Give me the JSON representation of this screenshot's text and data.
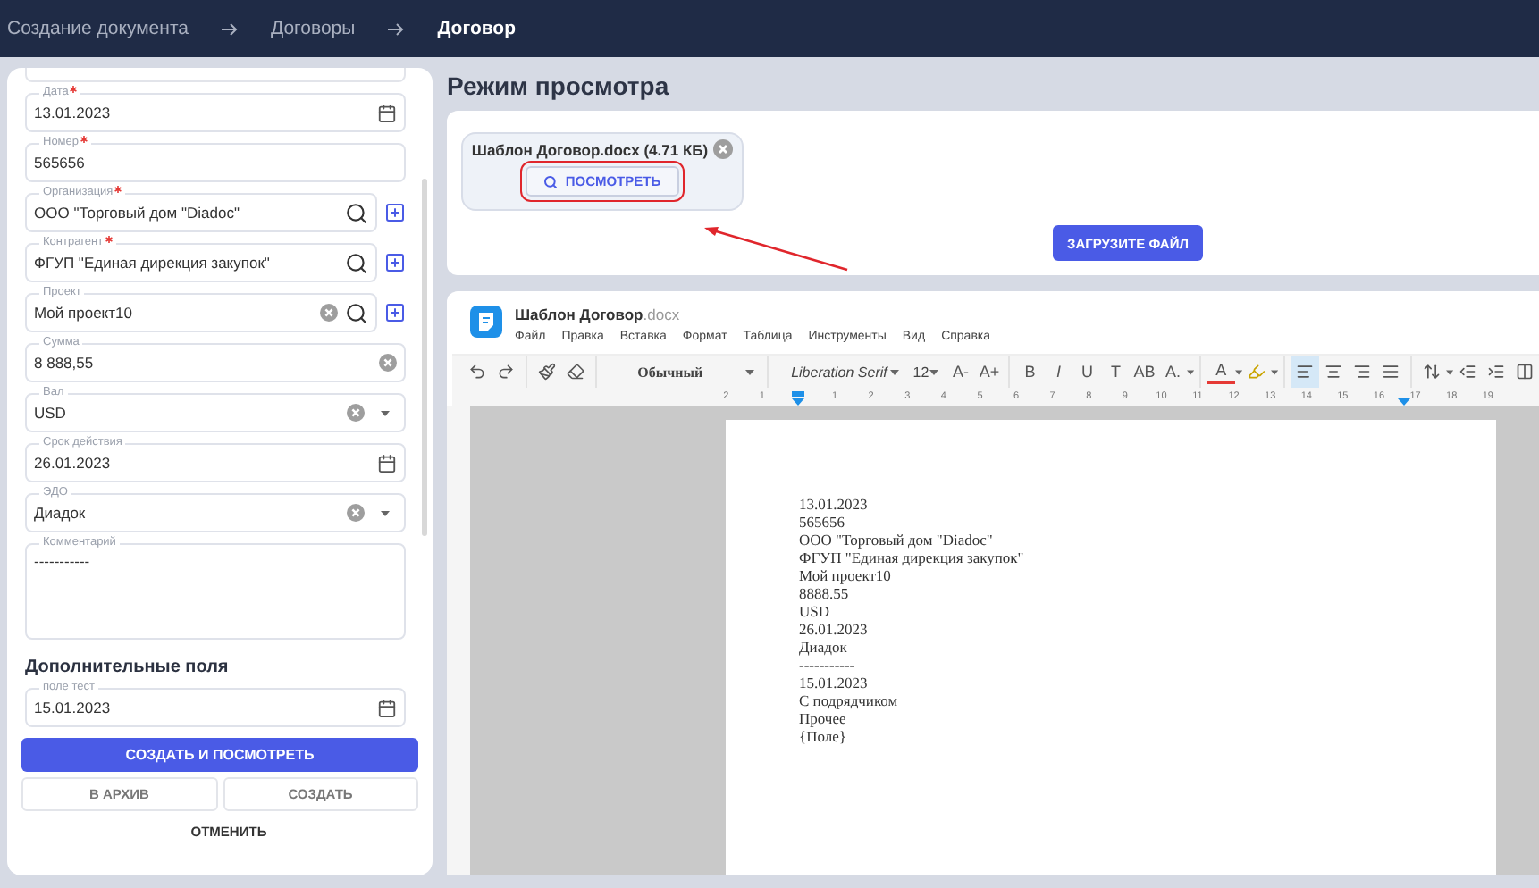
{
  "breadcrumbs": [
    {
      "label": "Создание документа",
      "selected": false
    },
    {
      "label": "Договоры",
      "selected": false
    },
    {
      "label": "Договор",
      "selected": true
    }
  ],
  "form": {
    "fields": [
      {
        "label": "Дата",
        "required": true,
        "value": "13.01.2023",
        "calendar": true
      },
      {
        "label": "Номер",
        "required": true,
        "value": "565656"
      },
      {
        "label": "Организация",
        "required": true,
        "value": "ООО \"Торговый дом \"Diadoc\"",
        "searchable": true,
        "addable": true
      },
      {
        "label": "Контрагент",
        "required": true,
        "value": "ФГУП \"Единая дирекция закупок\"",
        "searchable": true,
        "addable": true
      },
      {
        "label": "Проект",
        "value": "Мой проект10",
        "clearable": true,
        "searchable": true,
        "addable": true
      },
      {
        "label": "Сумма",
        "value": "8 888,55",
        "clearable": true
      },
      {
        "label": "Вал",
        "value": "USD",
        "clearable": true,
        "dropdown": true
      },
      {
        "label": "Срок действия",
        "value": "26.01.2023",
        "calendar": true
      },
      {
        "label": "ЭДО",
        "value": "Диадок",
        "clearable": true,
        "dropdown": true
      },
      {
        "label": "Комментарий",
        "value": "-----------",
        "multiline": true
      }
    ],
    "section_title": "Дополнительные поля",
    "extra_fields": [
      {
        "label": "поле тест",
        "value": "15.01.2023",
        "calendar": true
      }
    ],
    "primary_button": "СОЗДАТЬ И ПОСМОТРЕТЬ",
    "secondary_buttons": [
      "В АРХИВ",
      "СОЗДАТЬ"
    ],
    "cancel_button": "ОТМЕНИТЬ"
  },
  "preview": {
    "title": "Режим просмотра",
    "file": {
      "name": "Шаблон Договор.docx (4.71 КБ)",
      "view_button": "ПОСМОТРЕТЬ"
    },
    "upload_button": "ЗАГРУЗИТЕ ФАЙЛ"
  },
  "editor": {
    "doc_name": "Шаблон Договор",
    "doc_ext": ".docx",
    "menu": [
      "Файл",
      "Правка",
      "Вставка",
      "Формат",
      "Таблица",
      "Инструменты",
      "Вид",
      "Справка"
    ],
    "toolbar": {
      "style": "Обычный",
      "font": "Liberation Serif",
      "size": "12",
      "size_buttons": [
        "A-",
        "A+"
      ],
      "format_buttons": [
        "B",
        "I",
        "U",
        "T",
        "AB",
        "A."
      ],
      "color_button": "A",
      "alignment": [
        {
          "selected": true
        },
        {
          "selected": false
        },
        {
          "selected": false
        },
        {
          "selected": false
        }
      ]
    },
    "ruler": [
      "2",
      "1",
      "1",
      "2",
      "3",
      "4",
      "5",
      "6",
      "7",
      "8",
      "9",
      "10",
      "11",
      "12",
      "13",
      "14",
      "15",
      "16",
      "17",
      "18",
      "19"
    ],
    "lines": [
      "13.01.2023",
      "565656",
      "ООО \"Торговый дом \"Diadoc\"",
      "ФГУП \"Единая дирекция закупок\"",
      "Мой проект10",
      "8888.55",
      "USD",
      "26.01.2023",
      "Диадок",
      "-----------",
      "15.01.2023",
      "С подрядчиком",
      "Прочее",
      "{Поле}"
    ]
  }
}
